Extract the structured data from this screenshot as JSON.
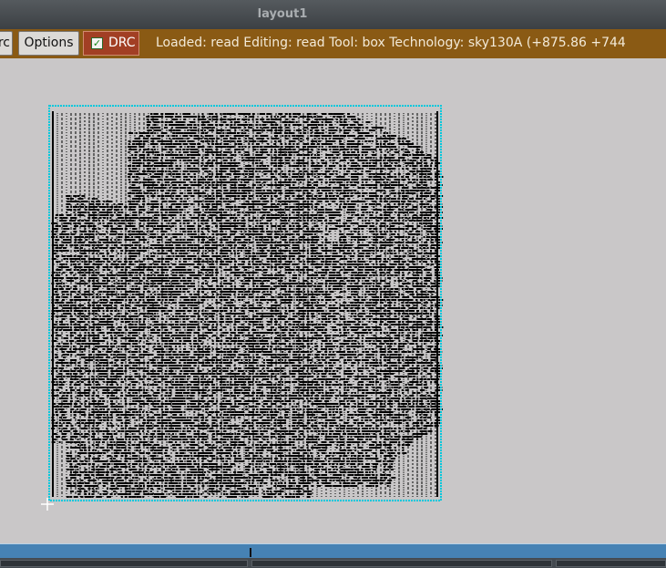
{
  "window": {
    "title": "layout1"
  },
  "toolbar": {
    "prev_button_label": "rc",
    "options_button_label": "Options",
    "drc_label": "DRC",
    "drc_checked": true,
    "check_glyph": "✓",
    "status_text": "Loaded: read Editing: read Tool: box  Technology: sky130A    (+875.86 +744"
  },
  "canvas": {
    "description_icon": "layout-geometry",
    "colors": {
      "background": "#c9c7c8",
      "geometry": "#000000",
      "boundary": "#00c8dc",
      "toolbar": "#8a5a14",
      "drc": "#a23f24",
      "statusbar": "#4682b4"
    }
  }
}
